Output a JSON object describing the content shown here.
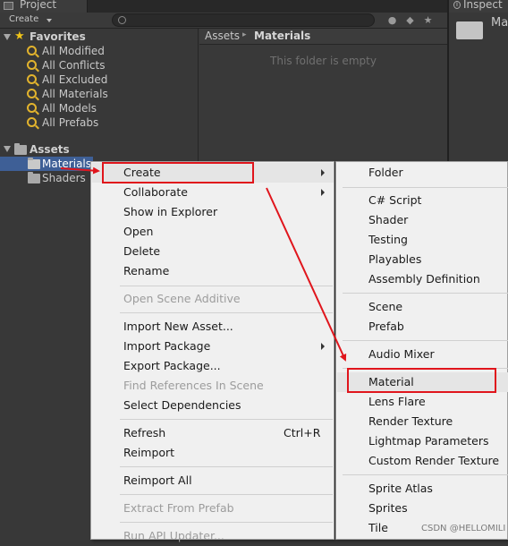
{
  "project_window": {
    "tab_title": "Project",
    "create_label": "Create",
    "favorites": {
      "title": "Favorites",
      "items": [
        "All Modified",
        "All Conflicts",
        "All Excluded",
        "All Materials",
        "All Models",
        "All Prefabs"
      ]
    },
    "assets": {
      "title": "Assets",
      "items": [
        "Materials",
        "Shaders"
      ],
      "selected": "Materials"
    },
    "breadcrumb": {
      "root": "Assets",
      "separator": "▸",
      "current": "Materials"
    },
    "empty_message": "This folder is empty"
  },
  "inspector": {
    "tab_title": "Inspect",
    "folder_name": "Mat"
  },
  "context_menu": {
    "create": "Create",
    "collaborate": "Collaborate",
    "show_in_explorer": "Show in Explorer",
    "open": "Open",
    "delete": "Delete",
    "rename": "Rename",
    "open_scene_additive": "Open Scene Additive",
    "import_new_asset": "Import New Asset...",
    "import_package": "Import Package",
    "export_package": "Export Package...",
    "find_references": "Find References In Scene",
    "select_dependencies": "Select Dependencies",
    "refresh": "Refresh",
    "refresh_shortcut": "Ctrl+R",
    "reimport": "Reimport",
    "reimport_all": "Reimport All",
    "extract_from_prefab": "Extract From Prefab",
    "run_api_updater": "Run API Updater..."
  },
  "create_submenu": {
    "folder": "Folder",
    "csharp_script": "C# Script",
    "shader": "Shader",
    "testing": "Testing",
    "playables": "Playables",
    "assembly_definition": "Assembly Definition",
    "scene": "Scene",
    "prefab": "Prefab",
    "audio_mixer": "Audio Mixer",
    "material": "Material",
    "lens_flare": "Lens Flare",
    "render_texture": "Render Texture",
    "lightmap_parameters": "Lightmap Parameters",
    "custom_render_texture": "Custom Render Texture",
    "sprite_atlas": "Sprite Atlas",
    "sprites": "Sprites",
    "tile": "Tile"
  },
  "watermark": "CSDN @HELLOMILI",
  "colors": {
    "selection": "#3e5f96",
    "annotation_red": "#e0151c",
    "favorite_star": "#f0c419",
    "menu_bg": "#f0f0f0"
  }
}
